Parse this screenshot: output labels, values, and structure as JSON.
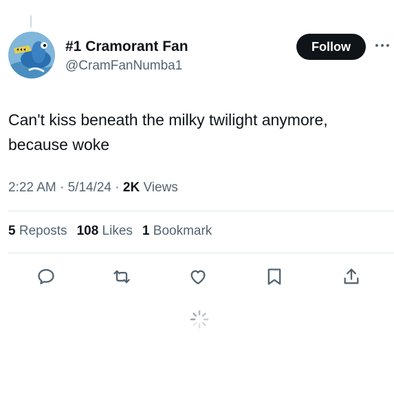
{
  "author": {
    "display_name": "#1 Cramorant Fan",
    "handle": "@CramFanNumba1"
  },
  "follow_label": "Follow",
  "tweet": {
    "line1": "Can't kiss beneath the milky twilight anymore,",
    "line2": "because woke"
  },
  "meta": {
    "time": "2:22 AM",
    "sep1": " · ",
    "date": "5/14/24",
    "sep2": " · ",
    "views_count": "2K",
    "views_label": " Views"
  },
  "stats": {
    "reposts_count": "5",
    "reposts_label": "Reposts",
    "likes_count": "108",
    "likes_label": "Likes",
    "bookmarks_count": "1",
    "bookmarks_label": "Bookmark"
  },
  "icons": [
    "reply-icon",
    "retweet-icon",
    "like-icon",
    "bookmark-icon",
    "share-icon",
    "more-icon",
    "loading-spinner-icon"
  ],
  "colors": {
    "text": "#0f1419",
    "secondary": "#536471",
    "divider": "#e1e8ed",
    "icon": "#536471"
  }
}
